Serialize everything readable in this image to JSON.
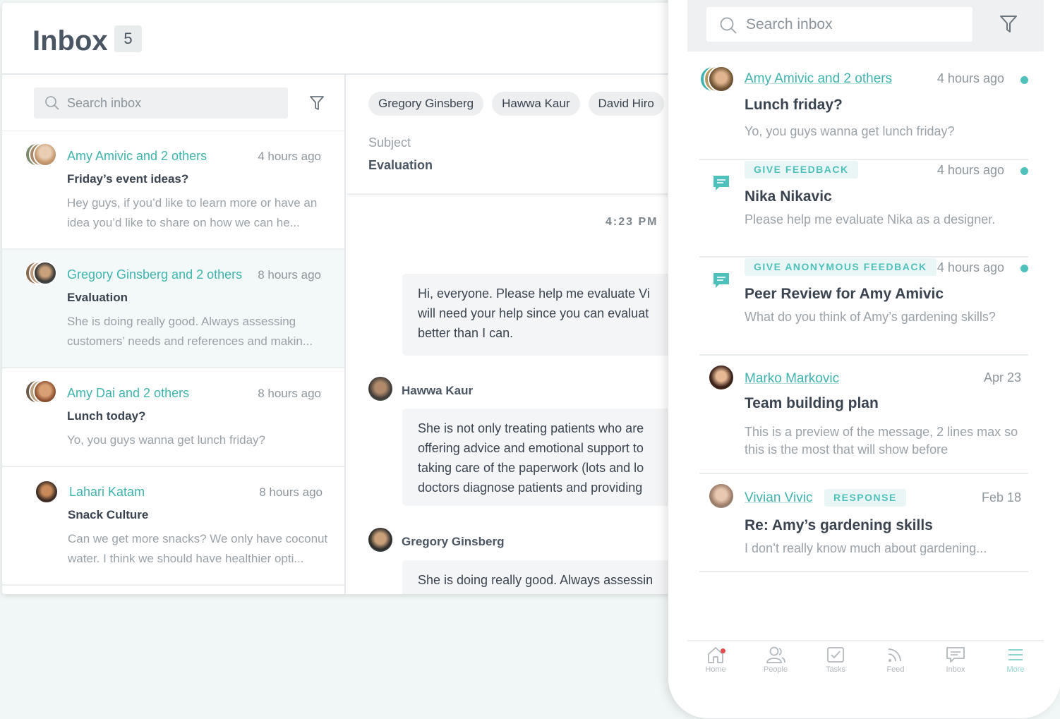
{
  "desktop": {
    "title": "Inbox",
    "count": "5",
    "search_placeholder": "Search inbox",
    "conversations": [
      {
        "who": "Amy Amivic and 2 others",
        "when": "4 hours ago",
        "subject": "Friday’s event ideas?",
        "preview": "Hey guys, if you’d like to learn more or have an idea  you’d like to share on how we can he..."
      },
      {
        "who": "Gregory Ginsberg and 2 others",
        "when": "8 hours ago",
        "subject": "Evaluation",
        "preview": "She is doing really good. Always assessing customers’ needs and references and makin..."
      },
      {
        "who": "Amy Dai and 2 others",
        "when": "8 hours ago",
        "subject": "Lunch today?",
        "preview": "Yo, you guys wanna get lunch friday?"
      },
      {
        "who": "Lahari Katam",
        "when": "8 hours ago",
        "subject": "Snack Culture",
        "preview": "Can we get more snacks? We only have coconut water. I think we should have healthier opti..."
      }
    ],
    "detail": {
      "participants": [
        "Gregory Ginsberg",
        "Hawwa Kaur",
        "David Hiro"
      ],
      "subject_label": "Subject",
      "subject_value": "Evaluation",
      "timestamp": "4:23 PM",
      "messages": [
        {
          "sender": "",
          "text": "Hi, everyone. Please help me evaluate Vi will need your help since you can evaluat better than I can."
        },
        {
          "sender": "Hawwa Kaur",
          "text": "She is not only treating patients who are offering advice and emotional support to taking care of the paperwork (lots and lo doctors diagnose patients and providing"
        },
        {
          "sender": "Gregory Ginsberg",
          "text": "She is doing really good. Always assessin"
        }
      ]
    }
  },
  "phone": {
    "search_placeholder": "Search inbox",
    "items": [
      {
        "who": "Amy Amivic and 2 others",
        "tag": "",
        "when": "4 hours ago",
        "unread": true,
        "subject": "Lunch friday?",
        "preview": "Yo, you guys wanna get lunch friday?"
      },
      {
        "who": "",
        "tag": "GIVE FEEDBACK",
        "when": "4 hours ago",
        "unread": true,
        "subject": "Nika Nikavic",
        "preview": "Please help me evaluate Nika as a designer."
      },
      {
        "who": "",
        "tag": "GIVE ANONYMOUS FEEDBACK",
        "when": "4 hours ago",
        "unread": true,
        "subject": "Peer Review for Amy Amivic",
        "preview": "What do you think of Amy’s gardening skills?"
      },
      {
        "who": "Marko Markovic",
        "tag": "",
        "when": "Apr 23",
        "unread": false,
        "subject": "Team building plan",
        "preview": "This is a preview of the message, 2 lines max so this is the most that will show before"
      },
      {
        "who": "Vivian Vivic",
        "tag": "RESPONSE",
        "when": "Feb 18",
        "unread": false,
        "subject": "Re: Amy’s gardening skills",
        "preview": "I don’t really know much about gardening..."
      }
    ],
    "tabs": [
      {
        "label": "Home",
        "icon": "home-icon"
      },
      {
        "label": "People",
        "icon": "people-icon"
      },
      {
        "label": "Tasks",
        "icon": "tasks-icon"
      },
      {
        "label": "Feed",
        "icon": "feed-icon"
      },
      {
        "label": "Inbox",
        "icon": "inbox-icon"
      },
      {
        "label": "More",
        "icon": "menu-icon"
      }
    ]
  },
  "colors": {
    "accent": "#3fb3ad",
    "unread_dot": "#4ec1bb",
    "notification": "#e44b4b"
  }
}
